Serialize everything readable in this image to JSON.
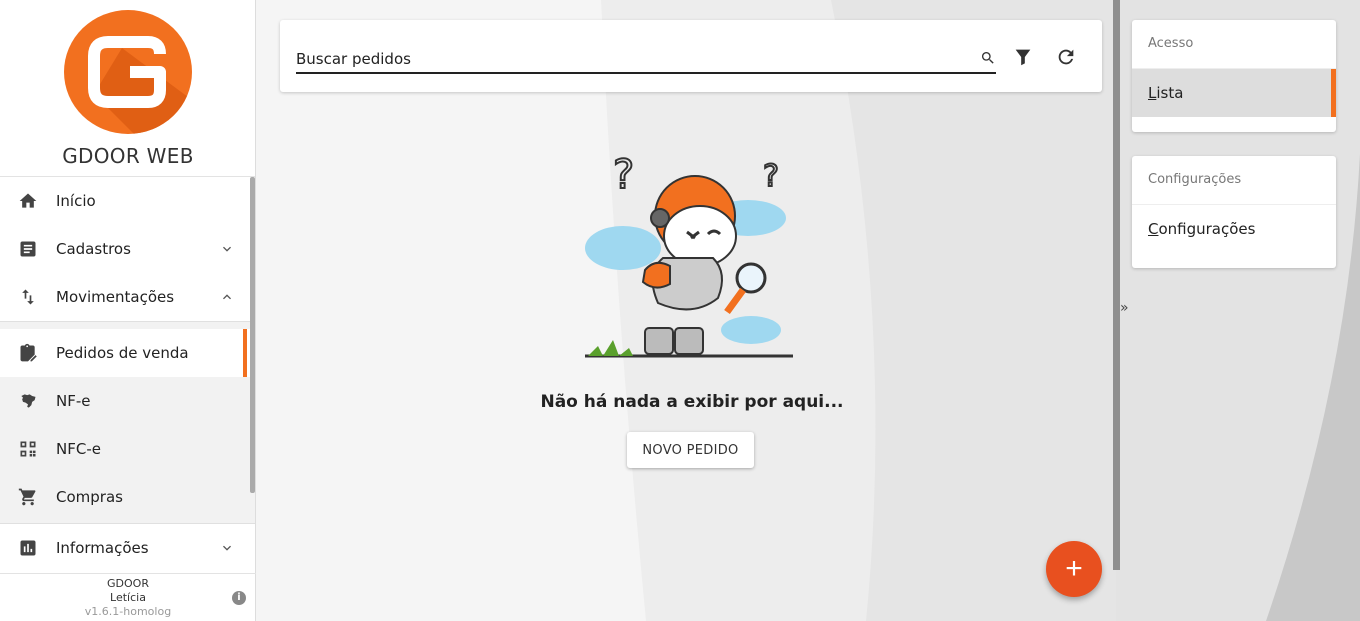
{
  "app": {
    "name": "GDOOR WEB"
  },
  "nav": {
    "inicio": "Início",
    "cadastros": "Cadastros",
    "movimentacoes": "Movimentações",
    "pedidos": "Pedidos de venda",
    "nfe": "NF-e",
    "nfce": "NFC-e",
    "compras": "Compras",
    "informacoes": "Informações"
  },
  "footer": {
    "company": "GDOOR",
    "user": "Letícia",
    "version": "v1.6.1-homolog"
  },
  "search": {
    "placeholder": "Buscar pedidos"
  },
  "empty": {
    "message": "Não há nada a exibir por aqui...",
    "button": "NOVO PEDIDO"
  },
  "panels": {
    "acesso": {
      "header": "Acesso",
      "item_first": "L",
      "item_rest": "ista"
    },
    "config": {
      "header": "Configurações",
      "item_first": "C",
      "item_rest": "onfigurações"
    }
  },
  "colors": {
    "accent": "#f2701f",
    "fab": "#e8501f"
  }
}
